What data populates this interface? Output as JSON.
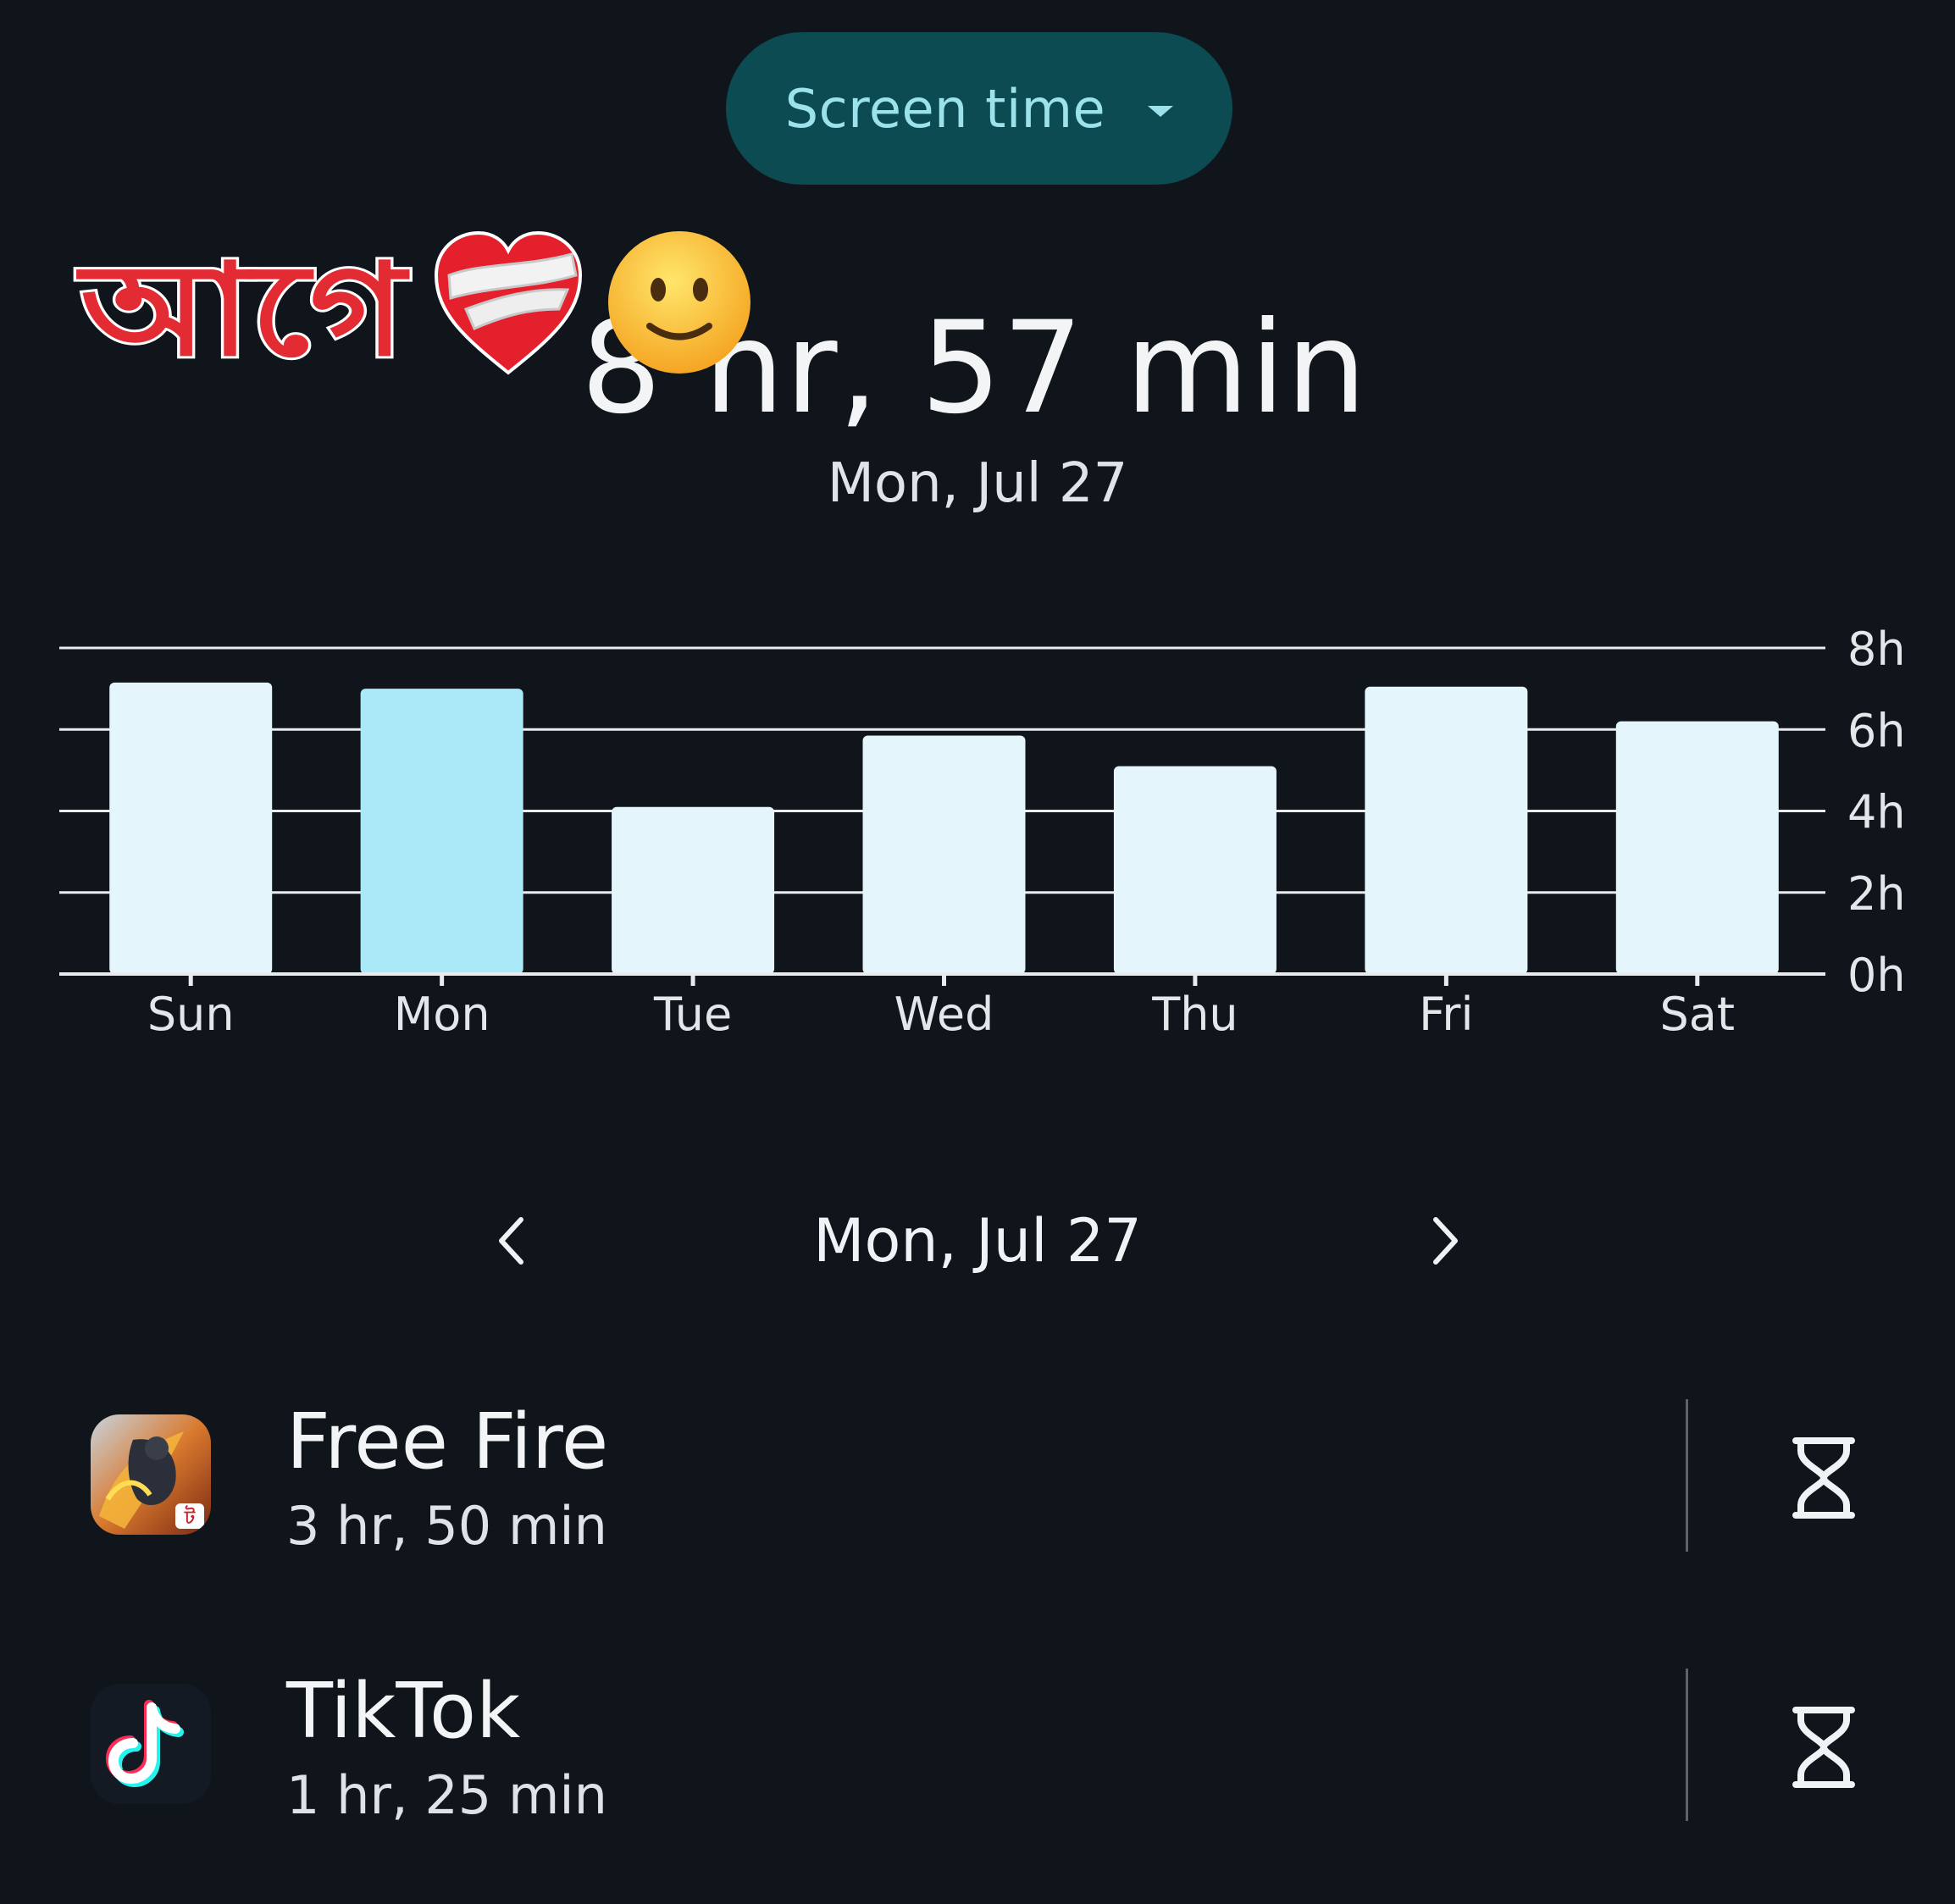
{
  "header": {
    "dropdown_label": "Screen time"
  },
  "overlay": {
    "sticker_text": "আগে"
  },
  "summary": {
    "total_time": "8 hr, 57 min",
    "date": "Mon, Jul 27"
  },
  "chart_data": {
    "type": "bar",
    "categories": [
      "Sun",
      "Mon",
      "Tue",
      "Wed",
      "Thu",
      "Fri",
      "Sat"
    ],
    "values": [
      7.15,
      7.0,
      4.1,
      5.85,
      5.1,
      7.05,
      6.2
    ],
    "selected_index": 1,
    "ylim": [
      0,
      8
    ],
    "yticks": [
      "0h",
      "2h",
      "4h",
      "6h",
      "8h"
    ],
    "title": "",
    "xlabel": "",
    "ylabel": "",
    "grid": true,
    "colors": {
      "bar": "#e4f5fb",
      "bar_selected": "#a9e9f8",
      "grid": "#e8ecef",
      "text": "#e3e7ea"
    }
  },
  "date_nav": {
    "label": "Mon, Jul 27"
  },
  "apps": [
    {
      "name": "Free Fire",
      "time": "3 hr, 50 min",
      "icon": "free-fire-icon"
    },
    {
      "name": "TikTok",
      "time": "1 hr, 25 min",
      "icon": "tiktok-icon"
    }
  ]
}
